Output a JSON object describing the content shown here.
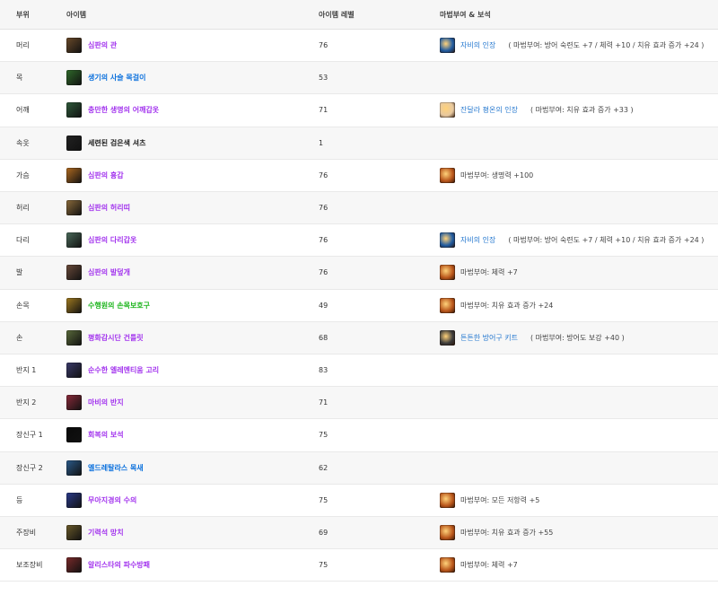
{
  "header": {
    "slot": "부위",
    "item": "아이템",
    "level": "아이템 레벨",
    "enchant": "마법부여 & 보석"
  },
  "rows": [
    {
      "slot": "머리",
      "item": "심판의 관",
      "quality": "epic",
      "level": "76",
      "icon_color": "#6a4a2a",
      "icon_name": "helm-icon",
      "gem": "자비의 인장",
      "gem_icon_color": "#1f5aa0",
      "enchant": "( 마법부여: 방어 숙련도 +7 / 체력 +10 / 치유 효과 증가 +24 )"
    },
    {
      "slot": "목",
      "item": "생기의 사슬 목걸이",
      "quality": "rare",
      "level": "53",
      "icon_color": "#2f6a2a",
      "icon_name": "necklace-icon",
      "gem": "",
      "gem_icon_color": "",
      "enchant": ""
    },
    {
      "slot": "어깨",
      "item": "충만한 생명의 어깨갑옷",
      "quality": "epic",
      "level": "71",
      "icon_color": "#2e5a3a",
      "icon_name": "shoulder-icon",
      "gem": "잔달라 평온의 인장",
      "gem_icon_color": "#e8c9a0",
      "enchant": "( 마법부여: 치유 효과 증가 +33 )"
    },
    {
      "slot": "속옷",
      "item": "세련된 검은색 셔츠",
      "quality": "common",
      "level": "1",
      "icon_color": "#222222",
      "icon_name": "shirt-icon",
      "gem": "",
      "gem_icon_color": "",
      "enchant": ""
    },
    {
      "slot": "가슴",
      "item": "심판의 흉갑",
      "quality": "epic",
      "level": "76",
      "icon_color": "#b06a20",
      "icon_name": "chest-icon",
      "gem": "",
      "gem_icon_color": "#b8551a",
      "enchant": "마법부여: 생명력 +100"
    },
    {
      "slot": "허리",
      "item": "심판의 허리띠",
      "quality": "epic",
      "level": "76",
      "icon_color": "#8a6a3a",
      "icon_name": "belt-icon",
      "gem": "",
      "gem_icon_color": "",
      "enchant": ""
    },
    {
      "slot": "다리",
      "item": "심판의 다리갑옷",
      "quality": "epic",
      "level": "76",
      "icon_color": "#4a6a5a",
      "icon_name": "legs-icon",
      "gem": "자비의 인장",
      "gem_icon_color": "#1f5aa0",
      "enchant": "( 마법부여: 방어 숙련도 +7 / 체력 +10 / 치유 효과 증가 +24 )"
    },
    {
      "slot": "발",
      "item": "심판의 발덮개",
      "quality": "epic",
      "level": "76",
      "icon_color": "#6a4a3a",
      "icon_name": "boots-icon",
      "gem": "",
      "gem_icon_color": "#b8551a",
      "enchant": "마법부여: 체력 +7"
    },
    {
      "slot": "손목",
      "item": "수행원의 손목보호구",
      "quality": "uncommon",
      "level": "49",
      "icon_color": "#a07a20",
      "icon_name": "bracer-icon",
      "gem": "",
      "gem_icon_color": "#b8551a",
      "enchant": "마법부여: 치유 효과 증가 +24"
    },
    {
      "slot": "손",
      "item": "평화감시단 건틀릿",
      "quality": "epic",
      "level": "68",
      "icon_color": "#5a6a3a",
      "icon_name": "gloves-icon",
      "gem": "튼튼한 방어구 키트",
      "gem_icon_color": "#3a3a3a",
      "enchant": "( 마법부여: 방어도 보강 +40 )"
    },
    {
      "slot": "반지 1",
      "item": "순수한 엘레멘티움 고리",
      "quality": "epic",
      "level": "83",
      "icon_color": "#3a3a6a",
      "icon_name": "ring-icon",
      "gem": "",
      "gem_icon_color": "",
      "enchant": ""
    },
    {
      "slot": "반지 2",
      "item": "마비의 반지",
      "quality": "epic",
      "level": "71",
      "icon_color": "#8a2a3a",
      "icon_name": "ring-icon",
      "gem": "",
      "gem_icon_color": "",
      "enchant": ""
    },
    {
      "slot": "장신구 1",
      "item": "회복의 보석",
      "quality": "epic",
      "level": "75",
      "icon_color": "#0a0a0a",
      "icon_name": "trinket-icon",
      "gem": "",
      "gem_icon_color": "",
      "enchant": ""
    },
    {
      "slot": "장신구 2",
      "item": "엘드레탈라스 목새",
      "quality": "rare",
      "level": "62",
      "icon_color": "#2a5a8a",
      "icon_name": "trinket-icon",
      "gem": "",
      "gem_icon_color": "",
      "enchant": ""
    },
    {
      "slot": "등",
      "item": "무아지경의 수의",
      "quality": "epic",
      "level": "75",
      "icon_color": "#2a3a8a",
      "icon_name": "cloak-icon",
      "gem": "",
      "gem_icon_color": "#b8551a",
      "enchant": "마법부여: 모든 저항력 +5"
    },
    {
      "slot": "주장비",
      "item": "기력석 망치",
      "quality": "epic",
      "level": "69",
      "icon_color": "#6a5a2a",
      "icon_name": "mace-icon",
      "gem": "",
      "gem_icon_color": "#b8551a",
      "enchant": "마법부여: 치유 효과 증가 +55"
    },
    {
      "slot": "보조장비",
      "item": "알리스타의 파수방패",
      "quality": "epic",
      "level": "75",
      "icon_color": "#7a2a2a",
      "icon_name": "shield-icon",
      "gem": "",
      "gem_icon_color": "#b8551a",
      "enchant": "마법부여: 체력 +7"
    }
  ]
}
